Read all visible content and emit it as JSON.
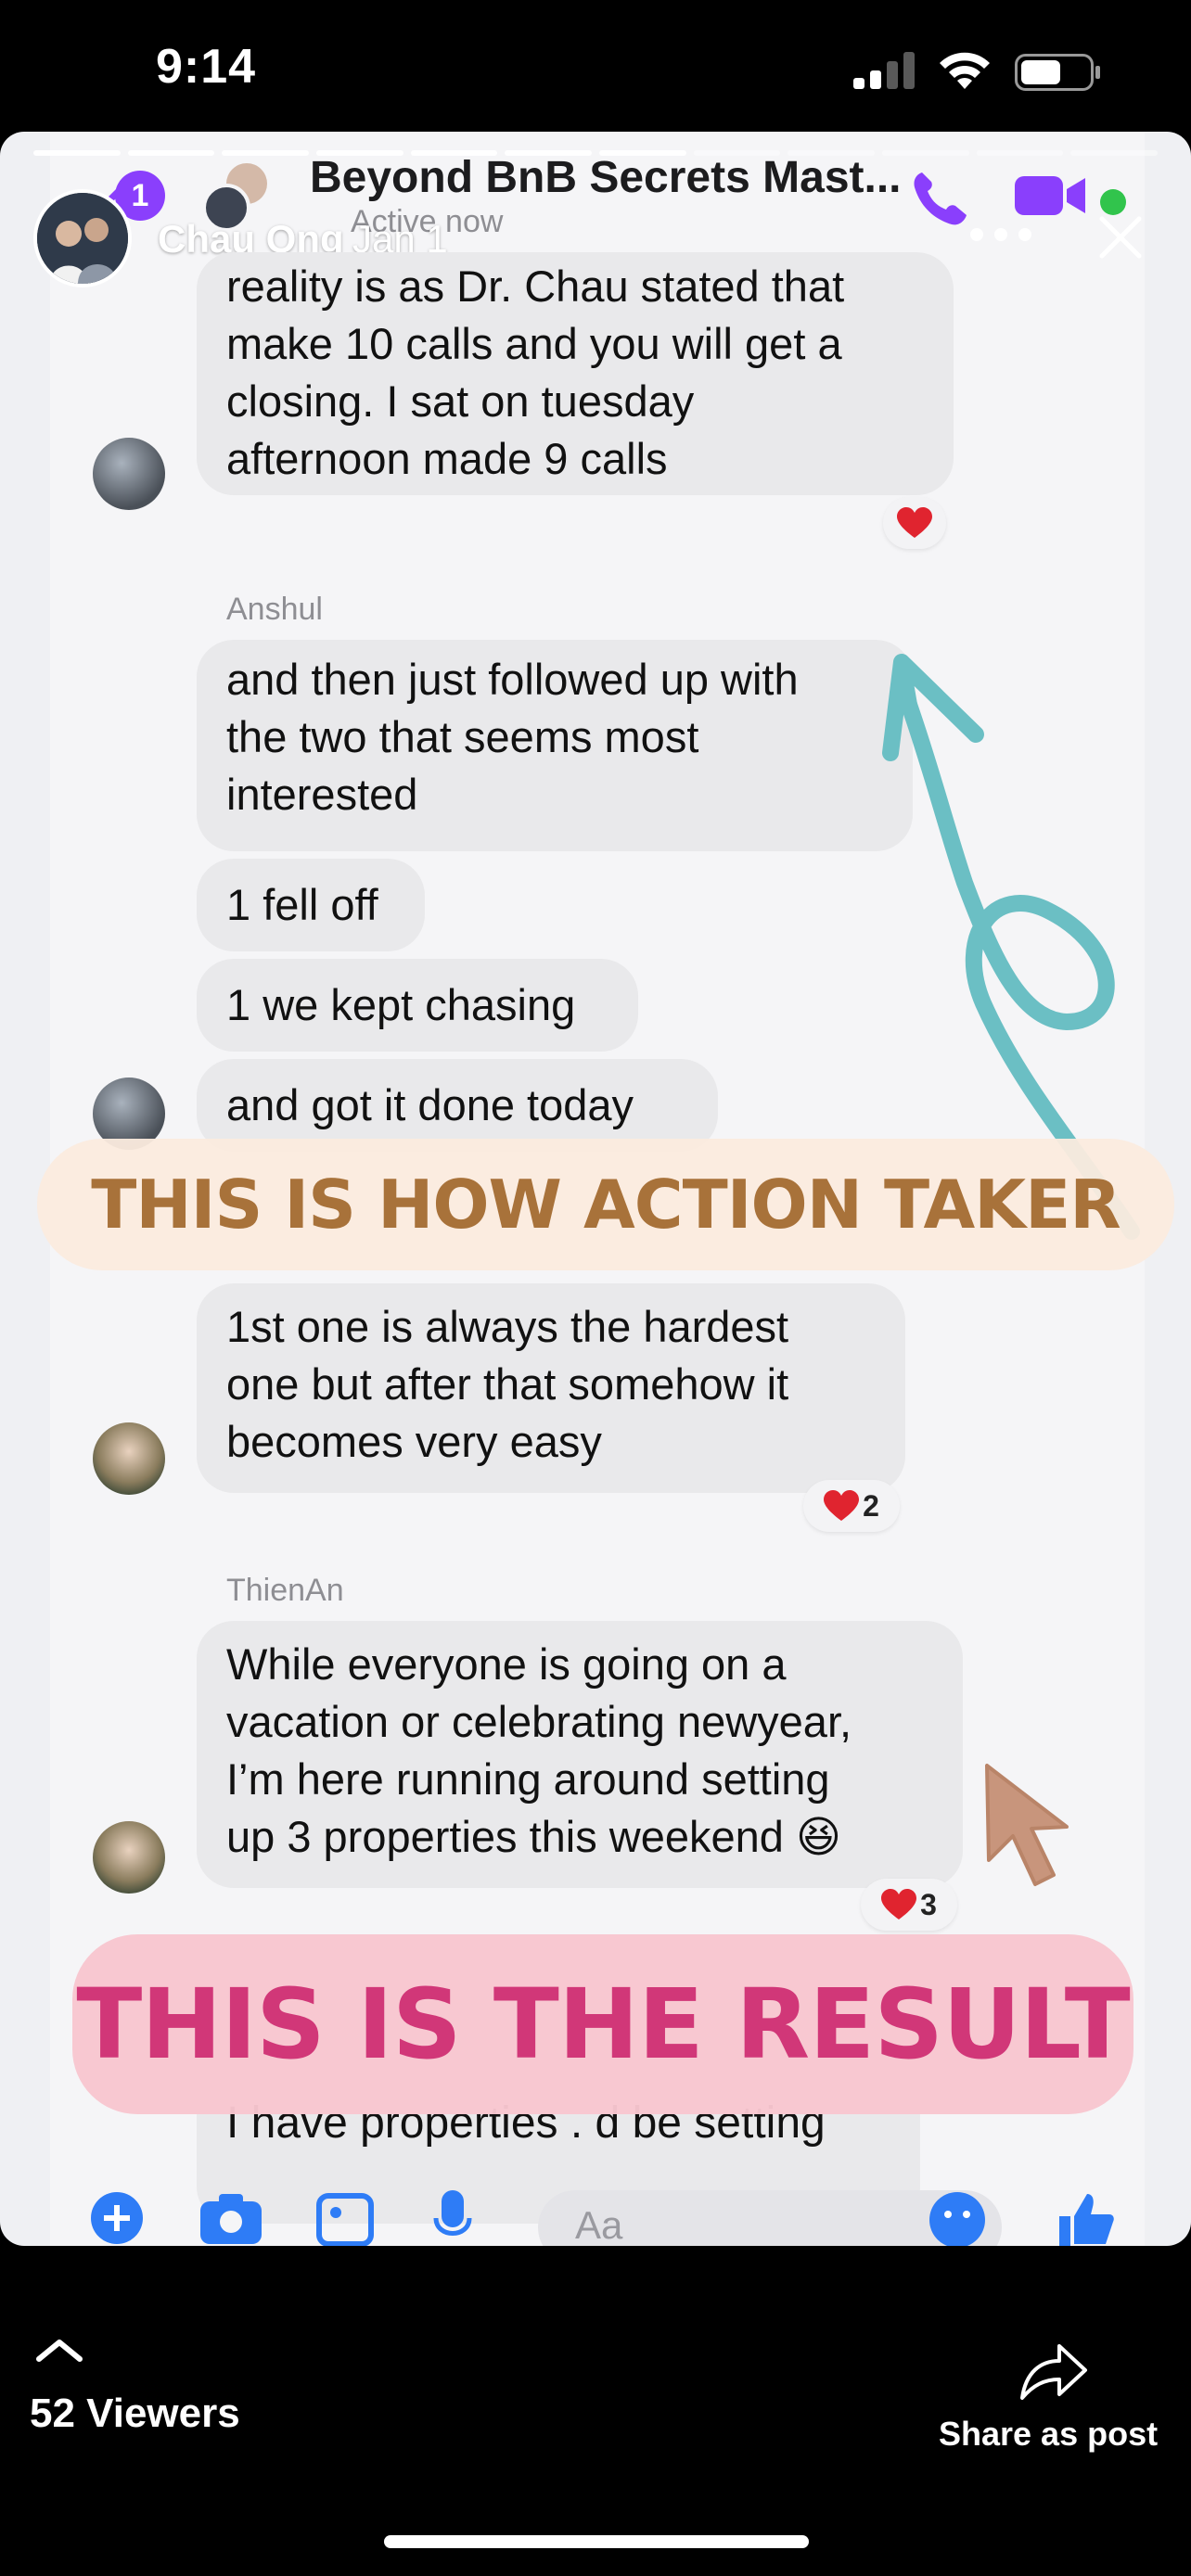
{
  "status_bar": {
    "time": "9:14"
  },
  "story": {
    "owner_name": "Chau Ong",
    "date": "Jan 1",
    "progress_total": 12,
    "progress_done": 7
  },
  "messenger_header": {
    "back_badge": "1",
    "title": "Beyond BnB Secrets Mast...",
    "status": "Active now"
  },
  "messages": [
    {
      "lines": [
        "reality is as Dr. Chau stated that",
        "make 10 calls and you will get a",
        "closing. I sat on tuesday",
        "afternoon made 9 calls"
      ]
    },
    {
      "sender": "Anshul",
      "lines": [
        "and then just followed up with",
        "the two that seems most",
        "interested"
      ]
    },
    {
      "lines": [
        "1 fell off"
      ]
    },
    {
      "lines": [
        "1 we kept chasing"
      ]
    },
    {
      "lines": [
        "and got it done today"
      ]
    },
    {
      "lines": [
        "1st one is always the hardest",
        "one but after that somehow it",
        "becomes very easy"
      ]
    },
    {
      "sender": "ThienAn",
      "lines": [
        "While everyone is going on a",
        "vacation or celebrating newyear,",
        "I’m here running around setting",
        "up 3 properties this weekend 😆"
      ]
    }
  ],
  "reactions": {
    "first": "",
    "hardest": "2",
    "thienan": "3"
  },
  "banners": {
    "action": "THIS IS HOW ACTION TAKER DO",
    "result": "THIS IS THE RESULT"
  },
  "partial_message": "I have properties . d be setting",
  "composer": {
    "placeholder": "Aa"
  },
  "bottom": {
    "viewers": "52 Viewers",
    "share": "Share as post"
  },
  "colors": {
    "messenger_purple": "#8a3ffc",
    "arrow_teal": "#6bbfc4",
    "banner_action_text": "#a8723a",
    "banner_result_text": "#d13778",
    "reaction_red": "#e0242f"
  }
}
